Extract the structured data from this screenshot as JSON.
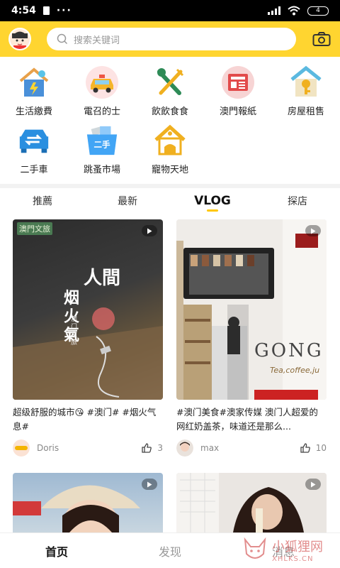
{
  "status_bar": {
    "time": "4:54",
    "dots": "···",
    "battery": "4"
  },
  "search": {
    "placeholder": "搜索关键词"
  },
  "categories": [
    {
      "label": "生活繳費",
      "icon": "house-utility-icon"
    },
    {
      "label": "電召的士",
      "icon": "taxi-icon"
    },
    {
      "label": "飲飲食食",
      "icon": "fork-knife-icon"
    },
    {
      "label": "澳門報紙",
      "icon": "newspaper-icon"
    },
    {
      "label": "房屋租售",
      "icon": "house-key-icon"
    },
    {
      "label": "二手車",
      "icon": "used-car-icon"
    },
    {
      "label": "跳蚤市場",
      "icon": "secondhand-box-icon"
    },
    {
      "label": "寵物天地",
      "icon": "pet-house-icon"
    }
  ],
  "tabs": [
    {
      "label": "推薦"
    },
    {
      "label": "最新"
    },
    {
      "label": "VLOG",
      "active": true
    },
    {
      "label": "探店"
    }
  ],
  "feed": [
    {
      "title": "超级舒服的城市😘 #澳门# #烟火气息#",
      "author": "Doris",
      "likes": "3",
      "thumb_text": {
        "badge": "澳門文旅",
        "headline_1": "人間",
        "headline_2": "烟火氣",
        "sub": "澳门文旅"
      }
    },
    {
      "title": "#澳门美食#澳家传媒 澳门人超爱的网红奶盖茶，味道还是那么...",
      "author": "max",
      "likes": "10",
      "thumb_text": {
        "sign": "GONG C",
        "sign_sub": "Tea,coffee,ju"
      }
    }
  ],
  "bottom_nav": [
    {
      "label": "首页",
      "active": true
    },
    {
      "label": "发现"
    },
    {
      "label": "消息"
    }
  ],
  "watermark": {
    "cn": "小狐狸网",
    "en": "XHLKS.CN"
  }
}
